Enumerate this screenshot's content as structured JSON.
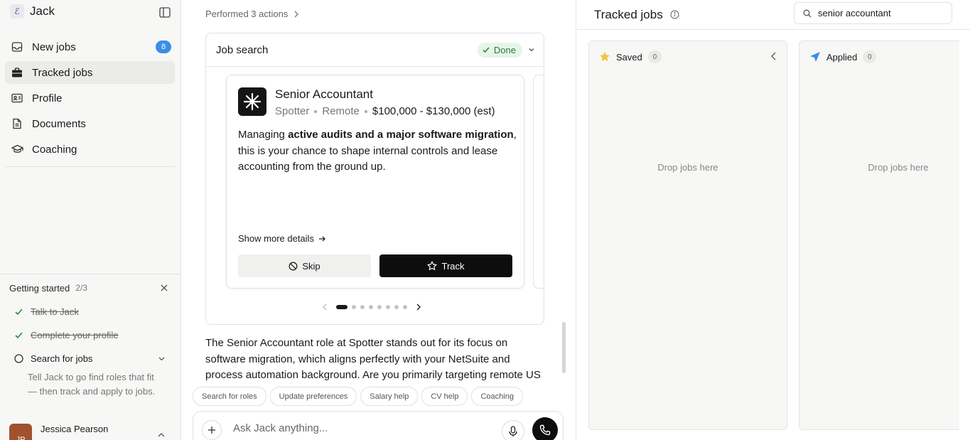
{
  "sidebar": {
    "brand_name": "Jack",
    "nav": [
      {
        "label": "New jobs",
        "badge": "8"
      },
      {
        "label": "Tracked jobs"
      },
      {
        "label": "Profile"
      },
      {
        "label": "Documents"
      },
      {
        "label": "Coaching"
      }
    ],
    "getting_started": {
      "title": "Getting started",
      "count": "2/3",
      "steps": [
        {
          "label": "Talk to Jack",
          "done": true
        },
        {
          "label": "Complete your profile",
          "done": true
        },
        {
          "label": "Search for jobs",
          "done": false
        }
      ],
      "description": "Tell Jack to go find roles that fit — then track and apply to jobs."
    },
    "user": {
      "initials": "JP",
      "name": "Jessica Pearson"
    }
  },
  "chat": {
    "performed": "Performed 3 actions",
    "card_title": "Job search",
    "status": "Done",
    "job": {
      "title": "Senior Accountant",
      "company": "Spotter",
      "location": "Remote",
      "salary": "$100,000 - $130,000 (est)",
      "desc_pre": "Managing ",
      "desc_bold": "active audits and a major software migration",
      "desc_post": ", this is your chance to shape internal controls and lease accounting from the ground up.",
      "more_label": "Show more details",
      "skip_label": "Skip",
      "track_label": "Track"
    },
    "pager": {
      "current": 1,
      "total": 8
    },
    "message": "The Senior Accountant role at Spotter stands out for its focus on software migration, which aligns perfectly with your NetSuite and process automation background. Are you primarily targeting remote US",
    "chips": [
      "Search for roles",
      "Update preferences",
      "Salary help",
      "CV help",
      "Coaching"
    ],
    "composer_placeholder": "Ask Jack anything..."
  },
  "tracked": {
    "title": "Tracked jobs",
    "search_value": "senior accountant",
    "columns": [
      {
        "label": "Saved",
        "count": "0",
        "empty": "Drop jobs here"
      },
      {
        "label": "Applied",
        "count": "0",
        "empty": "Drop jobs here"
      }
    ]
  },
  "colors": {
    "accent_blue": "#3b8de6",
    "done_green": "#2f7a3a",
    "saved_star": "#f5c242"
  }
}
